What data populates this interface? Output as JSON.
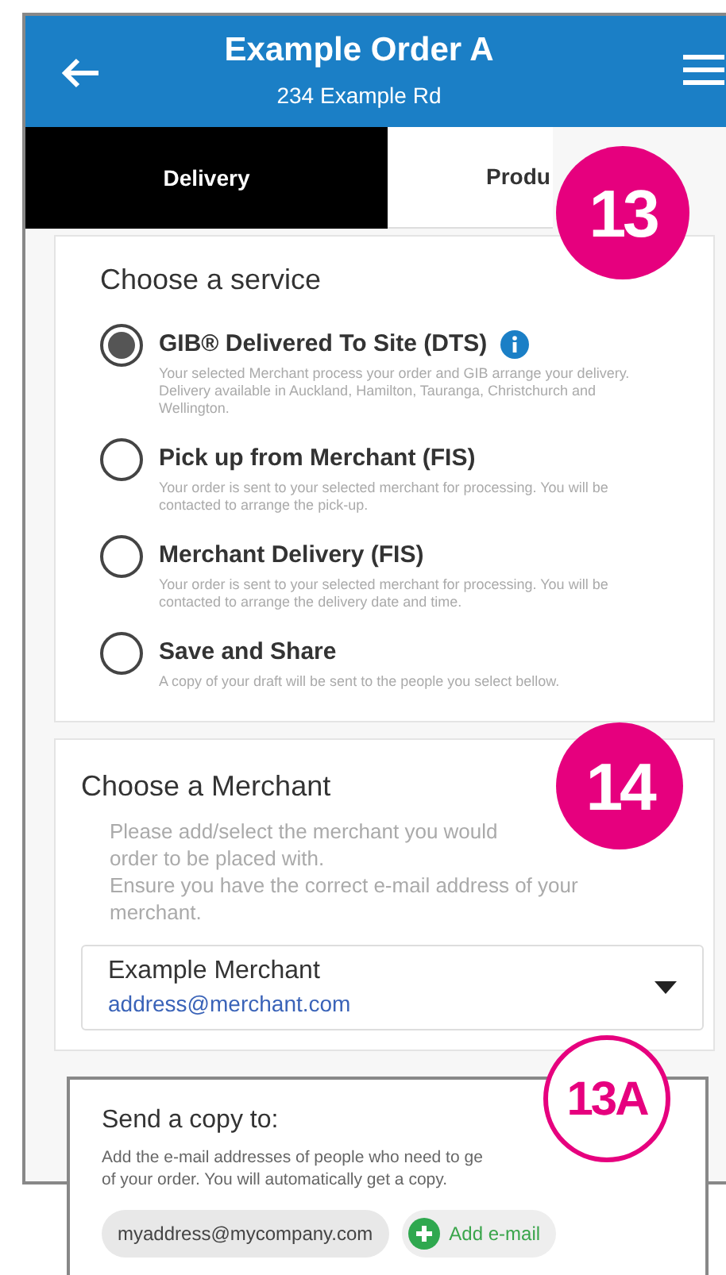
{
  "header": {
    "title": "Example Order A",
    "subtitle": "234 Example Rd"
  },
  "tabs": [
    {
      "label": "Delivery",
      "selected": true
    },
    {
      "label": "Produ",
      "selected": false
    }
  ],
  "service": {
    "title": "Choose a service",
    "options": [
      {
        "label": "GIB® Delivered To Site (DTS)",
        "info": true,
        "selected": true,
        "description": "Your selected Merchant process your order and GIB arrange your delivery. Delivery available in Auckland, Hamilton, Tauranga, Christchurch and Wellington."
      },
      {
        "label": "Pick up from Merchant (FIS)",
        "info": false,
        "selected": false,
        "description": "Your order is sent to your selected merchant for processing. You will be contacted to arrange the pick-up."
      },
      {
        "label": "Merchant Delivery (FIS)",
        "info": false,
        "selected": false,
        "description": "Your order is sent to your selected merchant for processing. You will be contacted to arrange the delivery date and time."
      },
      {
        "label": "Save and Share",
        "info": false,
        "selected": false,
        "description": "A copy of your draft will be sent to the people you select bellow."
      }
    ]
  },
  "merchant": {
    "title": "Choose a Merchant",
    "description_lines": [
      "Please add/select the merchant you would",
      "order to be placed with.",
      "Ensure you have the correct e-mail address of your",
      "merchant."
    ],
    "dropdown": {
      "name": "Example Merchant",
      "email": "address@merchant.com"
    }
  },
  "send_copy": {
    "title": "Send a copy to:",
    "description_lines": [
      "Add the e-mail addresses of people who need to ge",
      "of your order. You will automatically get a copy."
    ],
    "emails": [
      "myaddress@mycompany.com"
    ],
    "add_button": "Add e-mail"
  },
  "callouts": [
    {
      "label": "13",
      "kind": "filled"
    },
    {
      "label": "14",
      "kind": "filled"
    },
    {
      "label": "13A",
      "kind": "outline"
    }
  ]
}
